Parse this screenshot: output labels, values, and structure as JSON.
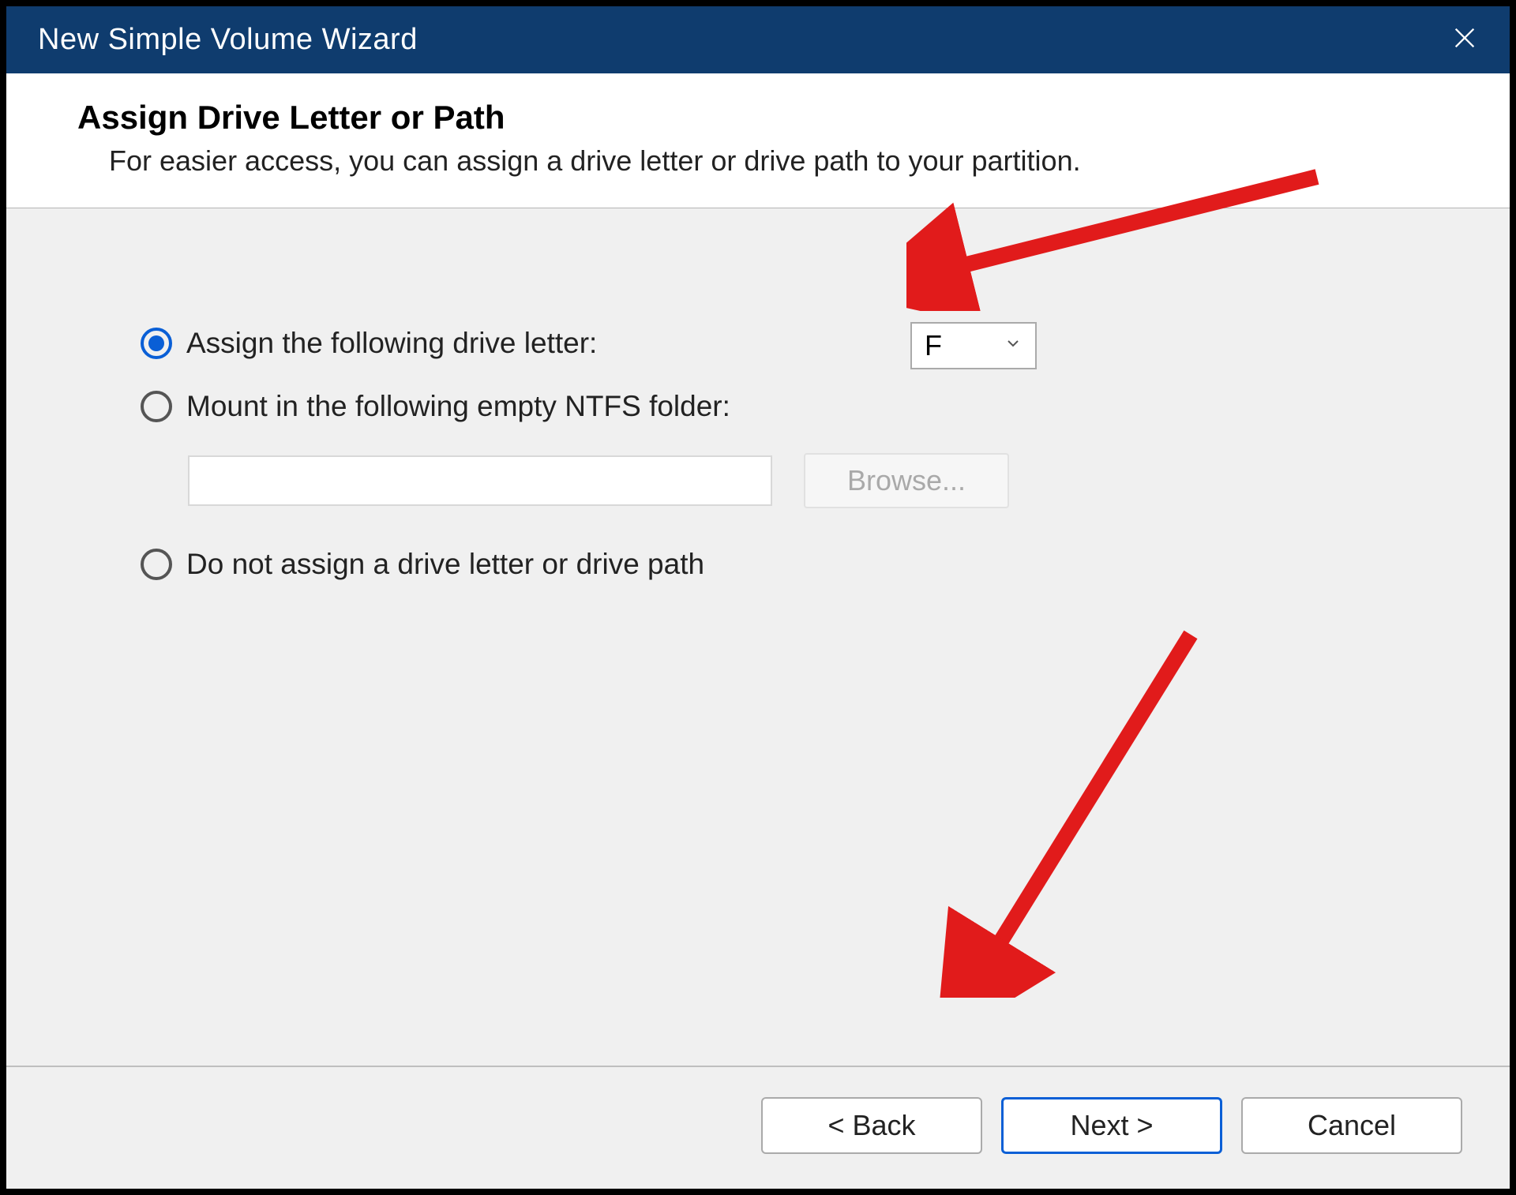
{
  "window": {
    "title": "New Simple Volume Wizard"
  },
  "header": {
    "heading": "Assign Drive Letter or Path",
    "subheading": "For easier access, you can assign a drive letter or drive path to your partition."
  },
  "options": {
    "assign_letter": {
      "label": "Assign the following drive letter:",
      "selected": true,
      "value": "F"
    },
    "mount_folder": {
      "label": "Mount in the following empty NTFS folder:",
      "selected": false,
      "path": "",
      "browse_label": "Browse..."
    },
    "no_assign": {
      "label": "Do not assign a drive letter or drive path",
      "selected": false
    }
  },
  "footer": {
    "back": "< Back",
    "next": "Next >",
    "cancel": "Cancel"
  },
  "annotations": {
    "arrow_color": "#e11b1b"
  }
}
